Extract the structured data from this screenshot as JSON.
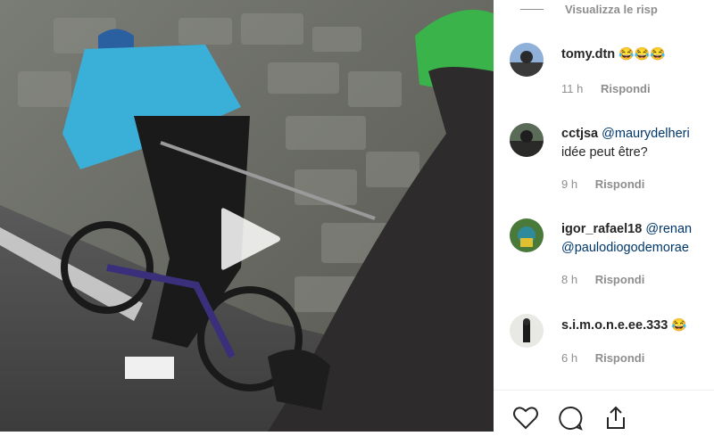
{
  "view_replies": {
    "label": "Visualizza le risp"
  },
  "comments": [
    {
      "username": "tomy.dtn",
      "text": "",
      "emoji": "😂😂😂",
      "time": "11 h",
      "reply_label": "Rispondi"
    },
    {
      "username": "cctjsa",
      "mention": "@maurydelheri",
      "text": "idée peut être?",
      "time": "9 h",
      "reply_label": "Rispondi"
    },
    {
      "username": "igor_rafael18",
      "mention": "@renan",
      "mention2": "@paulodiogodemorae",
      "time": "8 h",
      "reply_label": "Rispondi"
    },
    {
      "username": "s.i.m.o.n.e.ee.333",
      "emoji": "😂",
      "time": "6 h",
      "reply_label": "Rispondi"
    }
  ],
  "actions": {
    "like": "heart-icon",
    "comment": "comment-icon",
    "share": "share-icon"
  },
  "colors": {
    "text": "#262626",
    "muted": "#8e8e8e",
    "mention": "#00376b"
  }
}
